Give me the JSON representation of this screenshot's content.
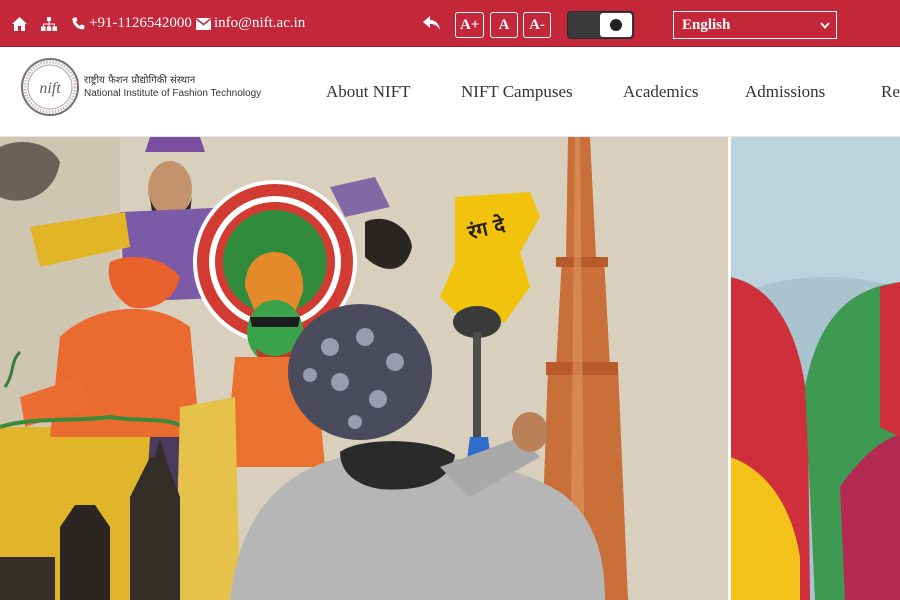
{
  "topbar": {
    "icons": [
      "home-icon",
      "sitemap-icon"
    ],
    "phone": "+91-1126542000",
    "email": "info@nift.ac.in",
    "font_controls": [
      "A+",
      "A",
      "A-"
    ],
    "contrast_toggle": "dark-mode-toggle",
    "language": "English"
  },
  "header": {
    "logo_text": "nift",
    "name_hindi": "राष्ट्रीय फैशन प्रौद्योगिकी संस्थान",
    "name_english": "National Institute of Fashion Technology",
    "nav": [
      "About NIFT",
      "NIFT Campuses",
      "Academics",
      "Admissions",
      "Re"
    ]
  },
  "hero": {
    "mural_text": "रंग दे"
  },
  "colors": {
    "topbar": "#c4273a",
    "nav_text": "#333333"
  }
}
